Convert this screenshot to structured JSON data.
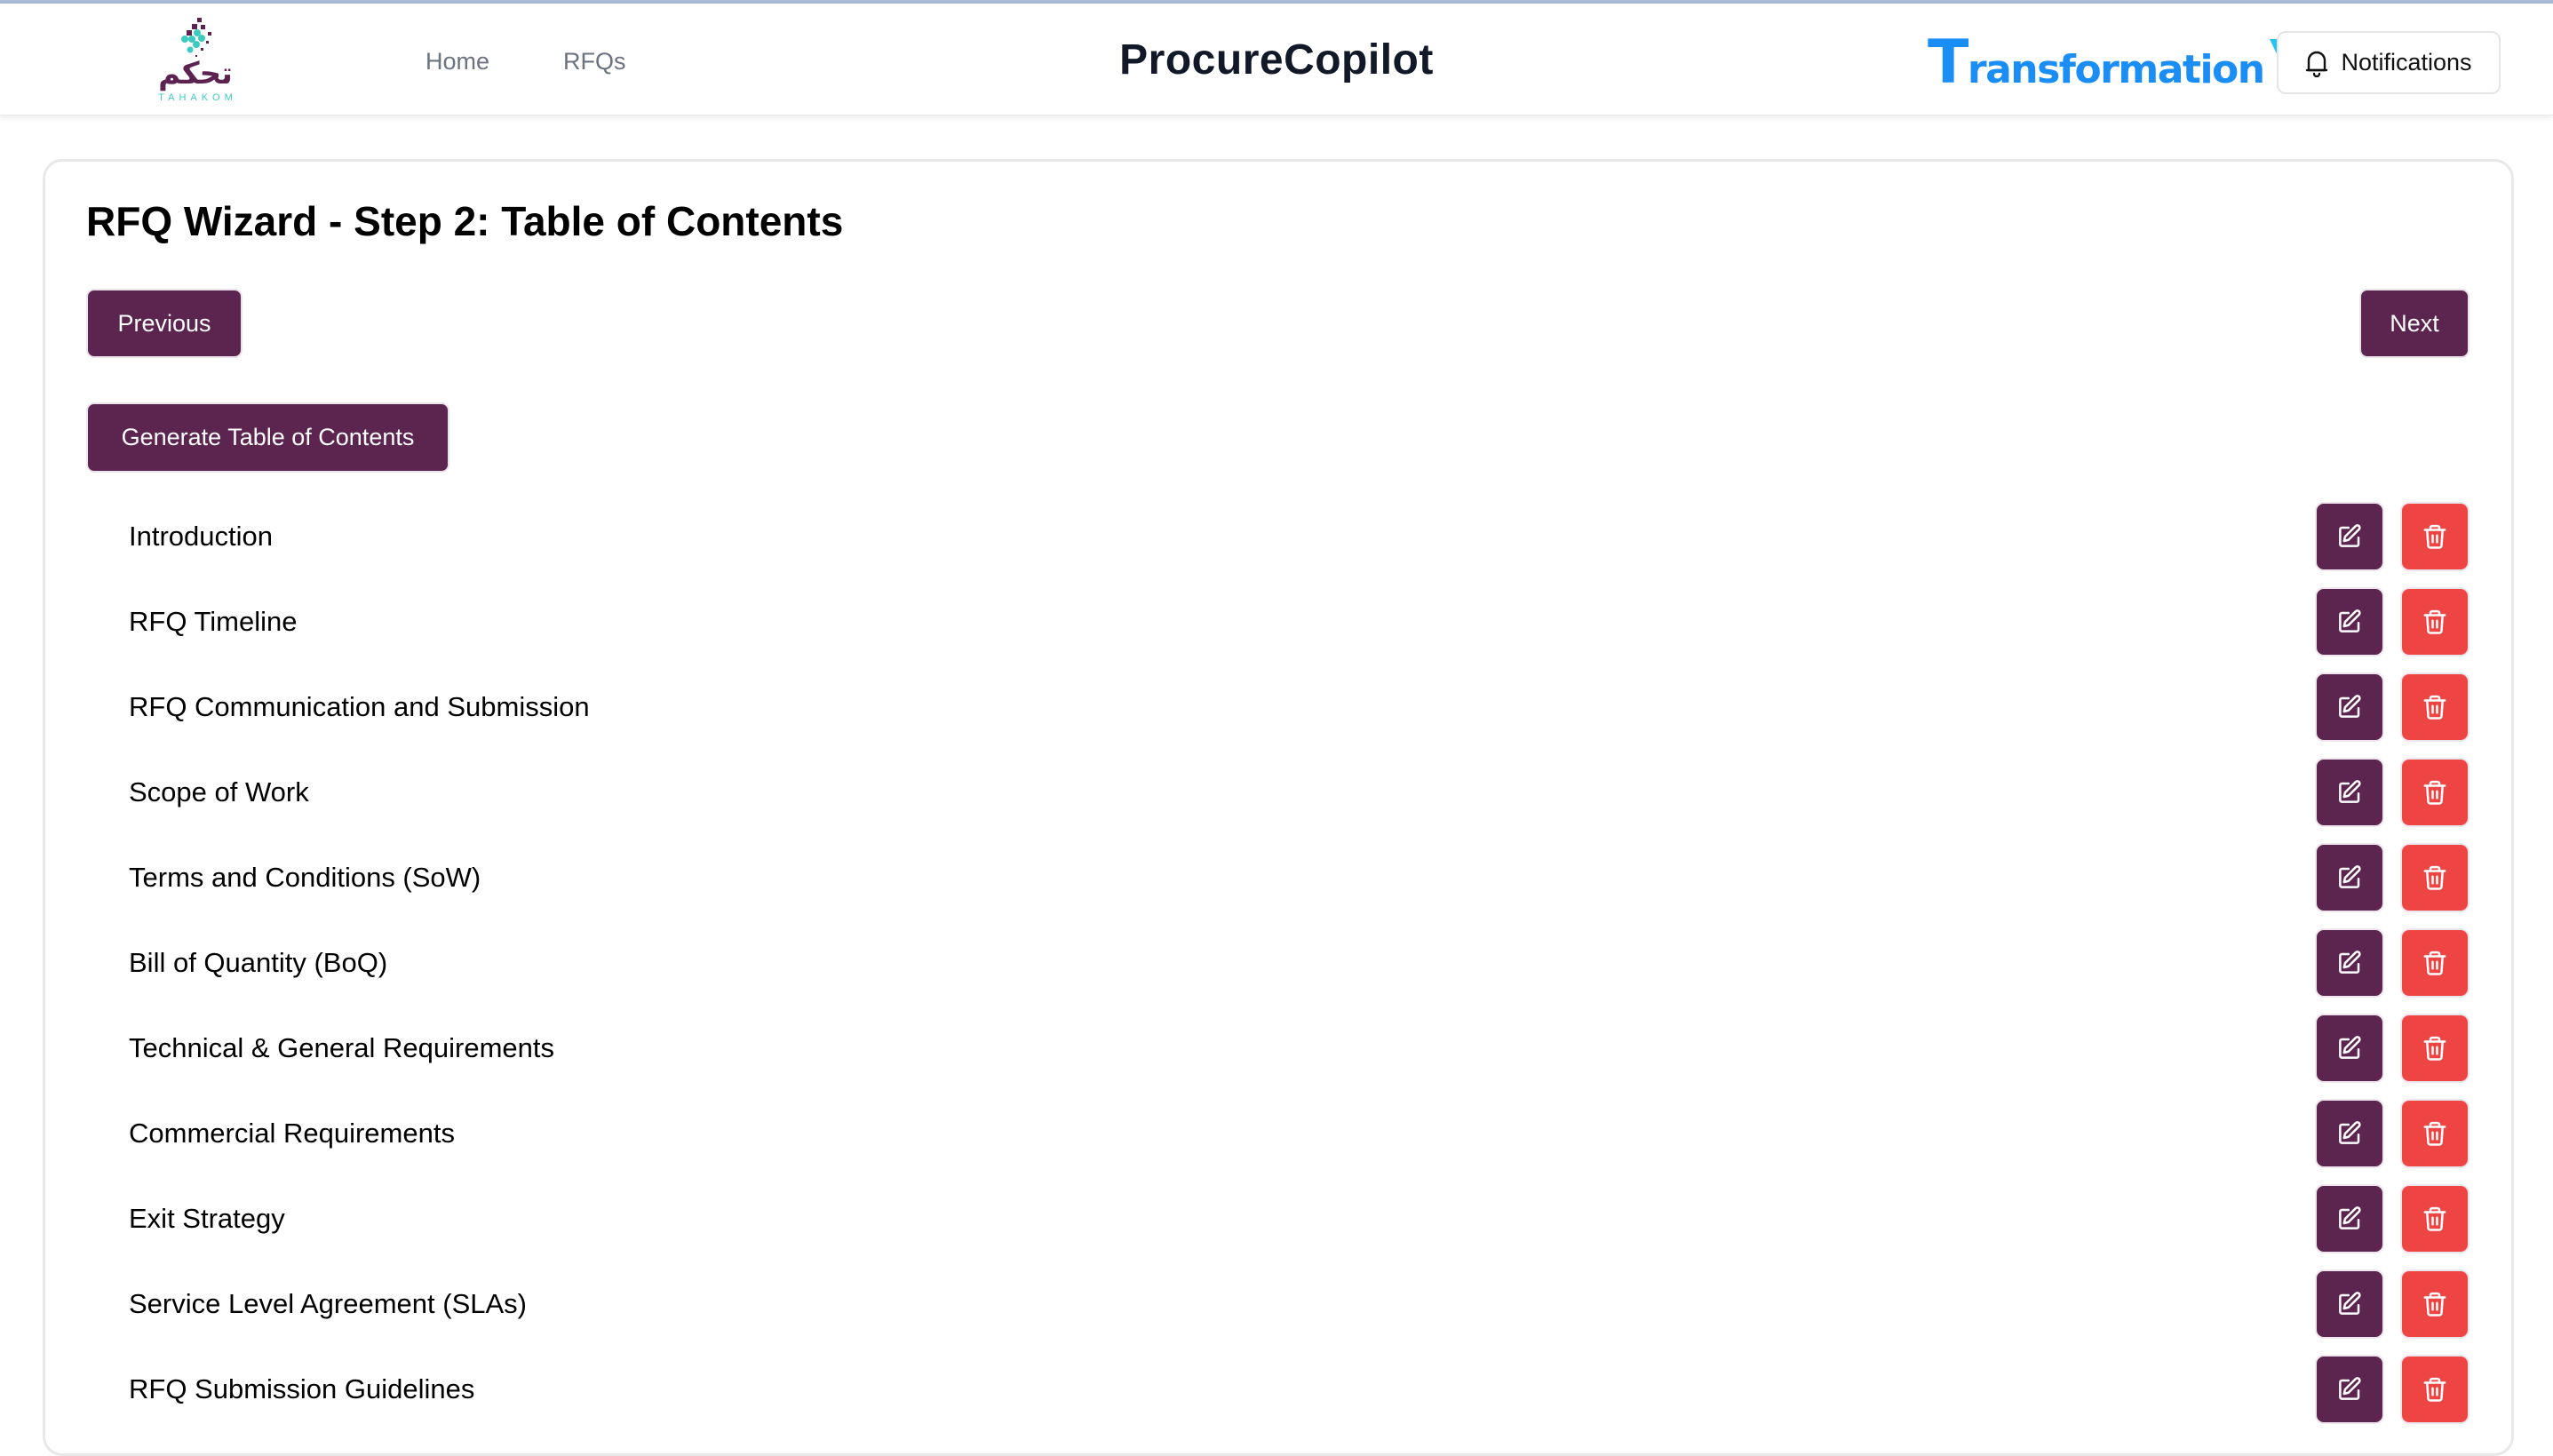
{
  "header": {
    "logo_arabic": "تحكم",
    "logo_latin": "TAHAKOM",
    "nav": [
      {
        "label": "Home"
      },
      {
        "label": "RFQs"
      }
    ],
    "app_title": "ProcureCopilot",
    "partner_logo": {
      "first_letter": "T",
      "rest": "ransformation",
      "suffix": "X"
    },
    "notifications_label": "Notifications",
    "notifications_icon": "bell-icon"
  },
  "wizard": {
    "heading": "RFQ Wizard - Step 2: Table of Contents",
    "previous_label": "Previous",
    "next_label": "Next",
    "generate_label": "Generate Table of Contents"
  },
  "toc": {
    "items": [
      {
        "title": "Introduction"
      },
      {
        "title": "RFQ Timeline"
      },
      {
        "title": "RFQ Communication and Submission"
      },
      {
        "title": "Scope of Work"
      },
      {
        "title": "Terms and Conditions (SoW)"
      },
      {
        "title": "Bill of Quantity (BoQ)"
      },
      {
        "title": "Technical & General Requirements"
      },
      {
        "title": "Commercial Requirements"
      },
      {
        "title": "Exit Strategy"
      },
      {
        "title": "Service Level Agreement (SLAs)"
      },
      {
        "title": "RFQ Submission Guidelines"
      }
    ],
    "edit_icon": "edit-icon",
    "delete_icon": "trash-icon"
  },
  "colors": {
    "primary": "#5b2550",
    "danger": "#ef4444",
    "nav_text": "#6b7280",
    "brand_teal": "#3ccbc0",
    "partner_blue": "#1a8ef5"
  }
}
